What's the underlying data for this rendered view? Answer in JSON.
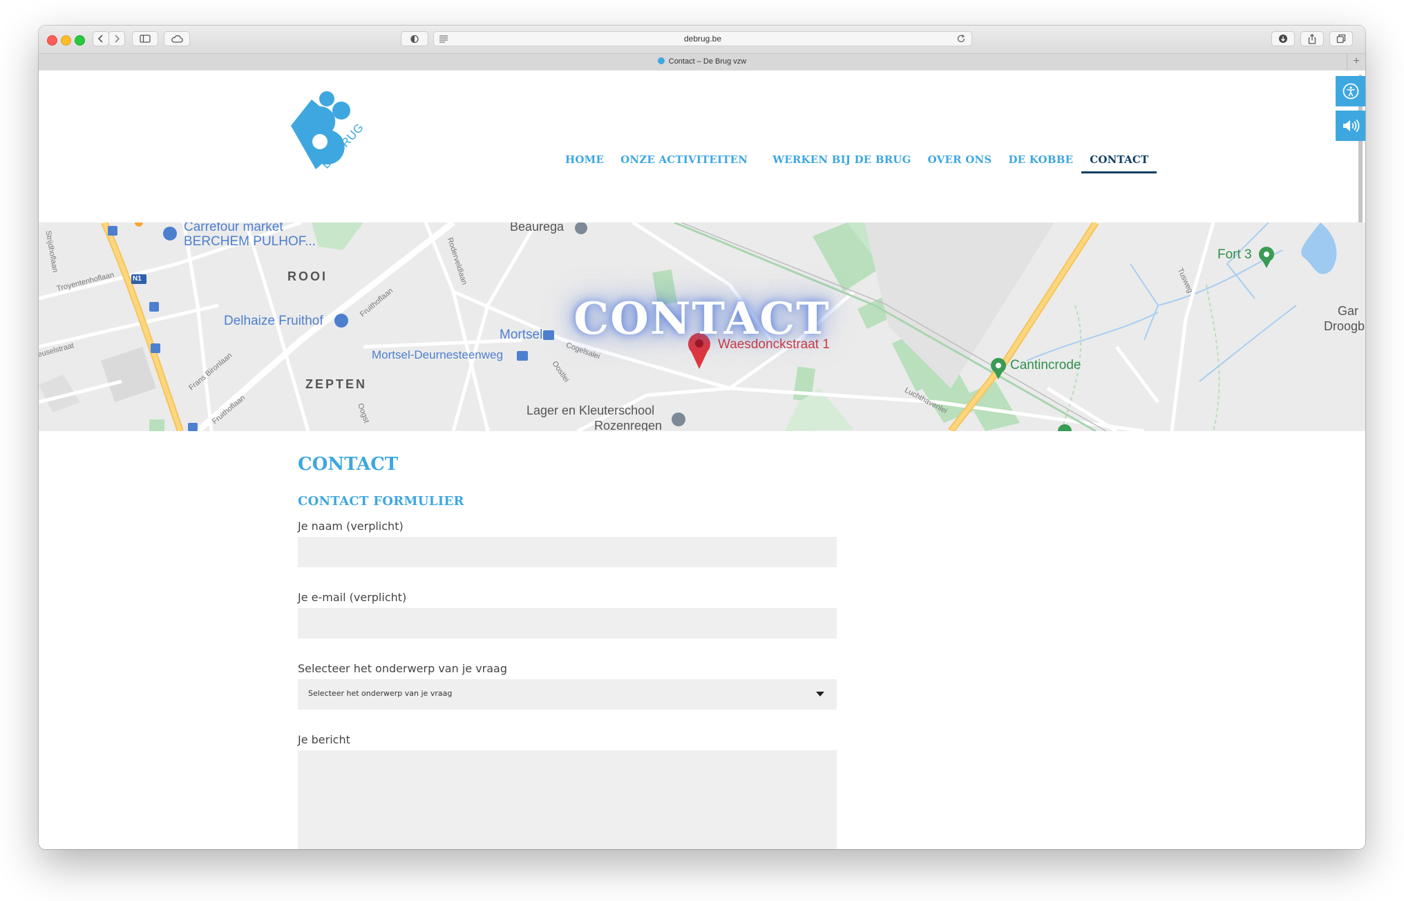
{
  "browser": {
    "url": "debrug.be",
    "tab_title": "Contact – De Brug vzw",
    "new_tab": "+"
  },
  "site": {
    "logo_text": "DE BRUG",
    "brand_color": "#3ea7e0",
    "active_color": "#0f3f63"
  },
  "nav": {
    "items": [
      {
        "label": "HOME"
      },
      {
        "label": "ONZE ACTIVITEITEN"
      },
      {
        "label": "WERKEN BIJ DE BRUG"
      },
      {
        "label": "OVER ONS"
      },
      {
        "label": "DE KOBBE"
      },
      {
        "label": "CONTACT"
      }
    ],
    "active": "CONTACT"
  },
  "accessibility": {
    "icons": [
      "accessibility-icon",
      "speaker-icon"
    ]
  },
  "hero": {
    "title": "CONTACT",
    "map_labels": {
      "carrefour": "Carrefour market",
      "carrefour_2": "BERCHEM PULHOF...",
      "beaurega": "Beaurega",
      "rooi": "ROOI",
      "delhaize": "Delhaize Fruithof",
      "zepten": "ZEPTEN",
      "mortsel": "Mortsel",
      "mortsel_deurne": "Mortsel-Deurnesteenweg",
      "waesdonck": "Waesdonckstraat 1",
      "lager_school": "Lager en Kleuterschool",
      "rozenregen": "Rozenregen",
      "cantincrode": "Cantincrode",
      "fort3": "Fort 3",
      "gar": "Gar",
      "droogb": "Droogb",
      "n1": "N1",
      "fruithoflaan": "Fruithoflaan",
      "fruithoflaan_2": "Fruithoflaan",
      "roderveldlaan": "Roderveldlaan",
      "troyentenhoflaan": "Troyentenhoflaan",
      "frans_bironlaan": "Frans Bironlaan",
      "strijdhoflaan": "Strijdhoflaan",
      "coppelalei": "Cogelsalei",
      "oogst": "Oogst",
      "oostlei": "Oostlei",
      "reusel": "Reuselstraat",
      "luchthavenlei": "Luchthavenlei",
      "tusweg": "Tusweg"
    }
  },
  "content": {
    "heading": "CONTACT",
    "subheading": "CONTACT FORMULIER",
    "form": {
      "name_label": "Je naam (verplicht)",
      "name_value": "",
      "email_label": "Je e-mail (verplicht)",
      "email_value": "",
      "subject_label": "Selecteer het onderwerp van je vraag",
      "subject_selected": "Selecteer het onderwerp van je vraag",
      "message_label": "Je bericht",
      "message_value": ""
    }
  }
}
